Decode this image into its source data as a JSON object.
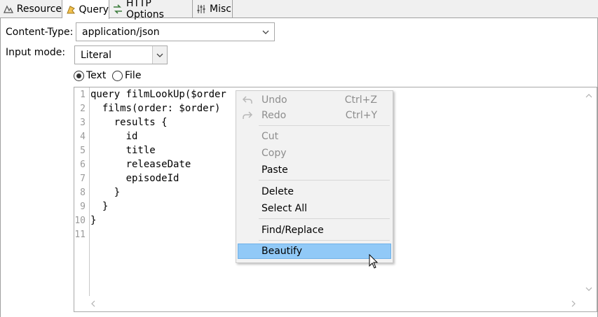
{
  "tabs": [
    {
      "label": "Resource",
      "icon": "resource-icon"
    },
    {
      "label": "Query",
      "icon": "query-icon"
    },
    {
      "label": "HTTP Options",
      "icon": "http-options-icon"
    },
    {
      "label": "Misc",
      "icon": "misc-icon"
    }
  ],
  "form": {
    "content_type_label": "Content-Type:",
    "content_type_value": "application/json",
    "input_mode_label": "Input mode:",
    "input_mode_value": "Literal",
    "radio_text_label": "Text",
    "radio_file_label": "File",
    "selected_radio": "Text"
  },
  "editor": {
    "line_numbers": [
      "1",
      "2",
      "3",
      "4",
      "5",
      "6",
      "7",
      "8",
      "9",
      "10",
      "11"
    ],
    "lines": [
      "query filmLookUp($order",
      "  films(order: $order)",
      "    results {",
      "      id",
      "      title",
      "      releaseDate",
      "      episodeId",
      "    }",
      "  }",
      "}",
      ""
    ]
  },
  "context_menu": {
    "undo": "Undo",
    "undo_shortcut": "Ctrl+Z",
    "redo": "Redo",
    "redo_shortcut": "Ctrl+Y",
    "cut": "Cut",
    "copy": "Copy",
    "paste": "Paste",
    "delete": "Delete",
    "select_all": "Select All",
    "find_replace": "Find/Replace",
    "beautify": "Beautify",
    "highlighted": "Beautify"
  },
  "colors": {
    "menu_highlight": "#91c9f7",
    "disabled_text": "#8d8d8d",
    "tab_bar": "#f0f0f0"
  }
}
